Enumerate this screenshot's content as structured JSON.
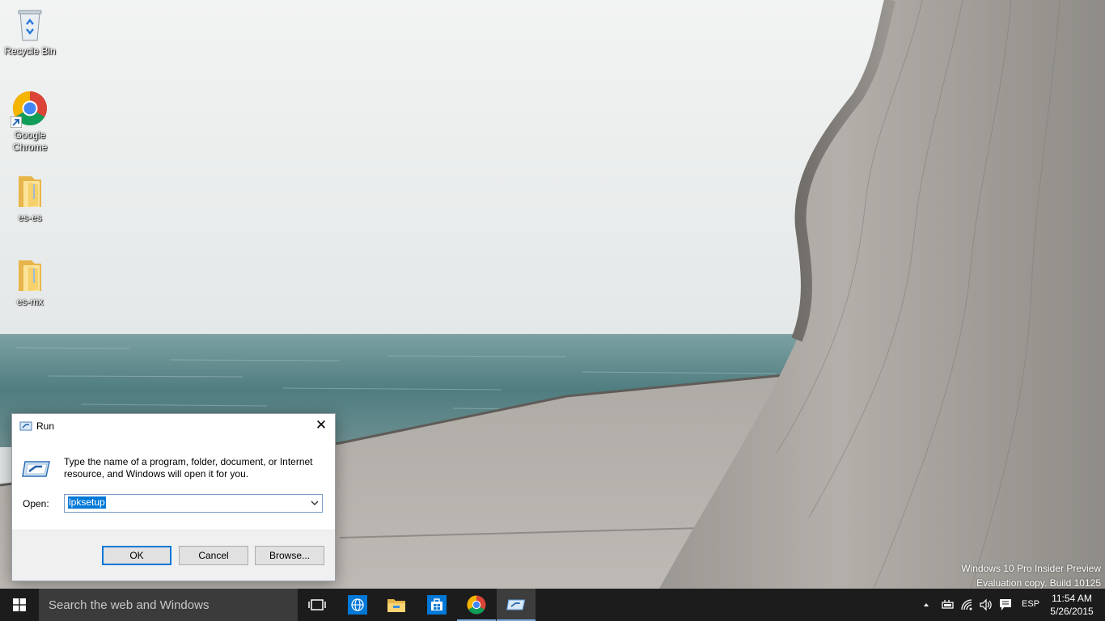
{
  "desktop": {
    "icons": [
      {
        "label": "Recycle Bin",
        "icon": "recycle-bin-icon"
      },
      {
        "label": "Google Chrome",
        "icon": "chrome-icon"
      },
      {
        "label": "es-es",
        "icon": "folder-icon"
      },
      {
        "label": "es-mx",
        "icon": "folder-icon"
      }
    ],
    "watermark": {
      "line1": "Windows 10 Pro Insider Preview",
      "line2": "Evaluation copy. Build 10125"
    }
  },
  "run_dialog": {
    "title": "Run",
    "description": "Type the name of a program, folder, document, or Internet resource, and Windows will open it for you.",
    "open_label": "Open:",
    "open_value": "lpksetup",
    "buttons": {
      "ok": "OK",
      "cancel": "Cancel",
      "browse": "Browse..."
    }
  },
  "taskbar": {
    "search_placeholder": "Search the web and Windows",
    "apps": [
      {
        "name": "Task View",
        "icon": "task-view-icon"
      },
      {
        "name": "Internet Explorer",
        "icon": "globe-icon"
      },
      {
        "name": "File Explorer",
        "icon": "folder-icon"
      },
      {
        "name": "Store",
        "icon": "store-icon"
      },
      {
        "name": "Google Chrome",
        "icon": "chrome-icon"
      },
      {
        "name": "Run",
        "icon": "run-icon"
      }
    ],
    "tray": {
      "language": "ESP",
      "time": "11:54 AM",
      "date": "5/26/2015"
    }
  },
  "colors": {
    "taskbar_bg": "#1c1c1c",
    "search_bg": "#3b3b3b",
    "accent": "#0078d7"
  }
}
